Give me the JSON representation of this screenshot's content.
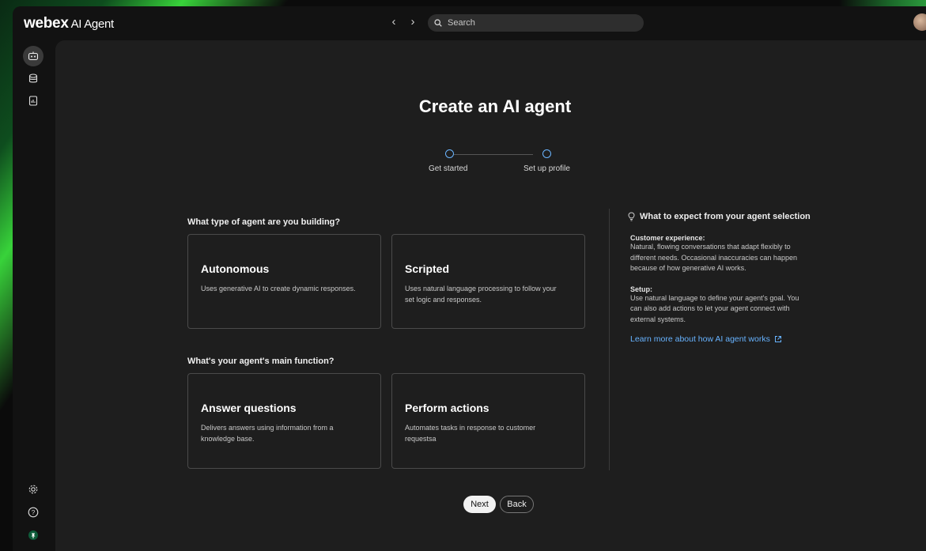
{
  "app": {
    "logo": "webex",
    "product": "AI Agent"
  },
  "search": {
    "placeholder": "Search"
  },
  "sidebar": {
    "top_items": [
      {
        "icon": "bot-icon",
        "active": true
      },
      {
        "icon": "database-icon"
      },
      {
        "icon": "report-icon"
      }
    ],
    "bottom_items": [
      {
        "icon": "gear-icon"
      },
      {
        "icon": "help-icon"
      },
      {
        "icon": "pin-icon"
      }
    ]
  },
  "page": {
    "title": "Create an AI agent",
    "steps": [
      {
        "label": "Get started"
      },
      {
        "label": "Set up profile"
      }
    ],
    "q1": "What type of agent are you building?",
    "type_options": [
      {
        "title": "Autonomous",
        "desc": "Uses generative AI to create dynamic responses."
      },
      {
        "title": "Scripted",
        "desc": "Uses natural language processing to follow your set logic and responses."
      }
    ],
    "q2": "What's your agent's main function?",
    "function_options": [
      {
        "title": "Answer questions",
        "desc": "Delivers answers using information from a knowledge base."
      },
      {
        "title": "Perform actions",
        "desc": "Automates tasks in response to customer requestsa"
      }
    ]
  },
  "info": {
    "heading": "What to expect from your agent selection",
    "cx_label": "Customer experience:",
    "cx_text": "Natural, flowing conversations that adapt flexibly to different needs. Occasional inaccuracies can happen because of how generative AI works.",
    "setup_label": "Setup:",
    "setup_text": "Use natural language to define your agent's goal. You can also add actions to let your agent connect with external systems.",
    "link": "Learn more about how AI agent works"
  },
  "buttons": {
    "next": "Next",
    "back": "Back"
  },
  "colors": {
    "accent": "#67b3ff",
    "background": "#1e1e1e"
  }
}
